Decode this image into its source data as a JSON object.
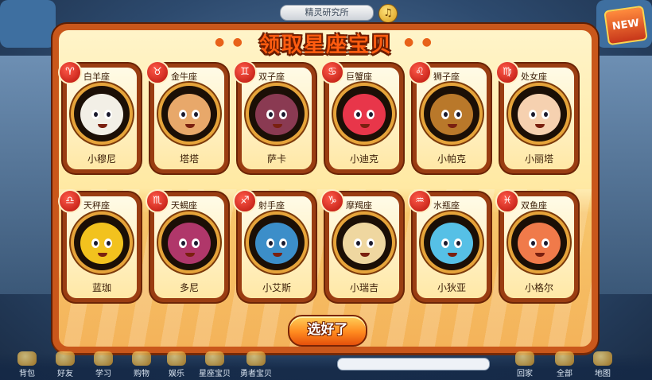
{
  "location_bar": {
    "text": "精灵研究所"
  },
  "icons": {
    "music": "music-note-icon",
    "new_badge": "NEW"
  },
  "title": "领取星座宝贝",
  "confirm_button": "选好了",
  "cards": [
    {
      "sign": "白羊座",
      "pet": "小穆尼",
      "symbol": "♈",
      "color": "#f2efe6"
    },
    {
      "sign": "金牛座",
      "pet": "塔塔",
      "symbol": "♉",
      "color": "#e8a86a"
    },
    {
      "sign": "双子座",
      "pet": "萨卡",
      "symbol": "♊",
      "color": "#8a3a52"
    },
    {
      "sign": "巨蟹座",
      "pet": "小迪克",
      "symbol": "♋",
      "color": "#e8364a"
    },
    {
      "sign": "狮子座",
      "pet": "小帕克",
      "symbol": "♌",
      "color": "#b9782a"
    },
    {
      "sign": "处女座",
      "pet": "小丽塔",
      "symbol": "♍",
      "color": "#f6d1b0"
    },
    {
      "sign": "天秤座",
      "pet": "蓝珈",
      "symbol": "♎",
      "color": "#f2c21e"
    },
    {
      "sign": "天蝎座",
      "pet": "多尼",
      "symbol": "♏",
      "color": "#b0376a"
    },
    {
      "sign": "射手座",
      "pet": "小艾斯",
      "symbol": "♐",
      "color": "#3c8ec9"
    },
    {
      "sign": "摩羯座",
      "pet": "小瑞吉",
      "symbol": "♑",
      "color": "#efd7a0"
    },
    {
      "sign": "水瓶座",
      "pet": "小狄亚",
      "symbol": "♒",
      "color": "#56c0e6"
    },
    {
      "sign": "双鱼座",
      "pet": "小格尔",
      "symbol": "♓",
      "color": "#f07a4a"
    }
  ],
  "toolbar": {
    "items": [
      "背包",
      "好友",
      "学习",
      "购物",
      "娱乐",
      "星座宝贝",
      "勇者宝贝",
      "回家",
      "全部",
      "地图"
    ]
  }
}
